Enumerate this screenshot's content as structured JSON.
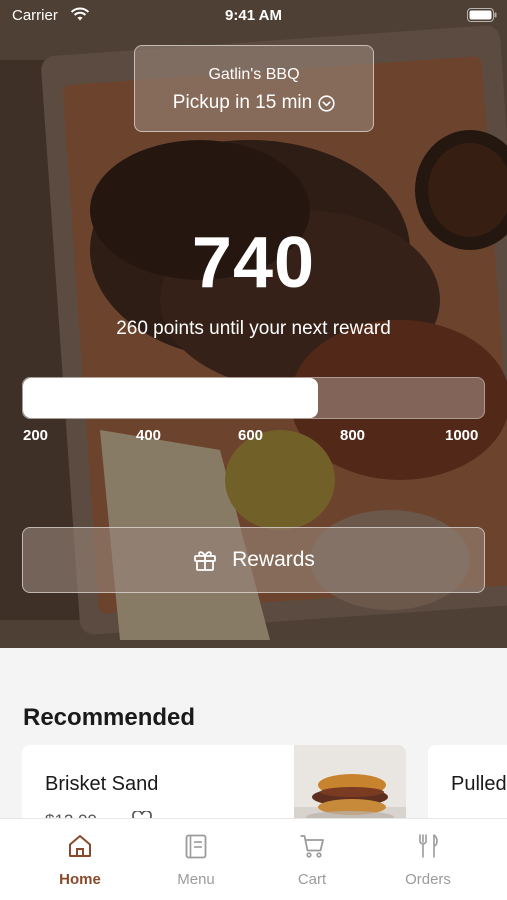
{
  "status_bar": {
    "carrier": "Carrier",
    "time": "9:41 AM"
  },
  "store": {
    "name": "Gatlin's BBQ",
    "pickup": "Pickup in 15 min"
  },
  "rewards": {
    "points": "740",
    "caption": "260 points until your next reward",
    "progress_fraction": 0.64,
    "ticks": [
      "200",
      "400",
      "600",
      "800",
      "1000"
    ],
    "button_label": "Rewards"
  },
  "recommended": {
    "title": "Recommended",
    "items": [
      {
        "name": "Brisket Sand",
        "price": "$12.99"
      },
      {
        "name": "Pulled"
      }
    ]
  },
  "tabs": [
    {
      "label": "Home",
      "icon": "home-icon",
      "active": true
    },
    {
      "label": "Menu",
      "icon": "menu-book-icon",
      "active": false
    },
    {
      "label": "Cart",
      "icon": "cart-icon",
      "active": false
    },
    {
      "label": "Orders",
      "icon": "fork-knife-icon",
      "active": false
    }
  ],
  "colors": {
    "accent": "#8a4a2a",
    "inactive_tab": "#9b9b9b"
  }
}
